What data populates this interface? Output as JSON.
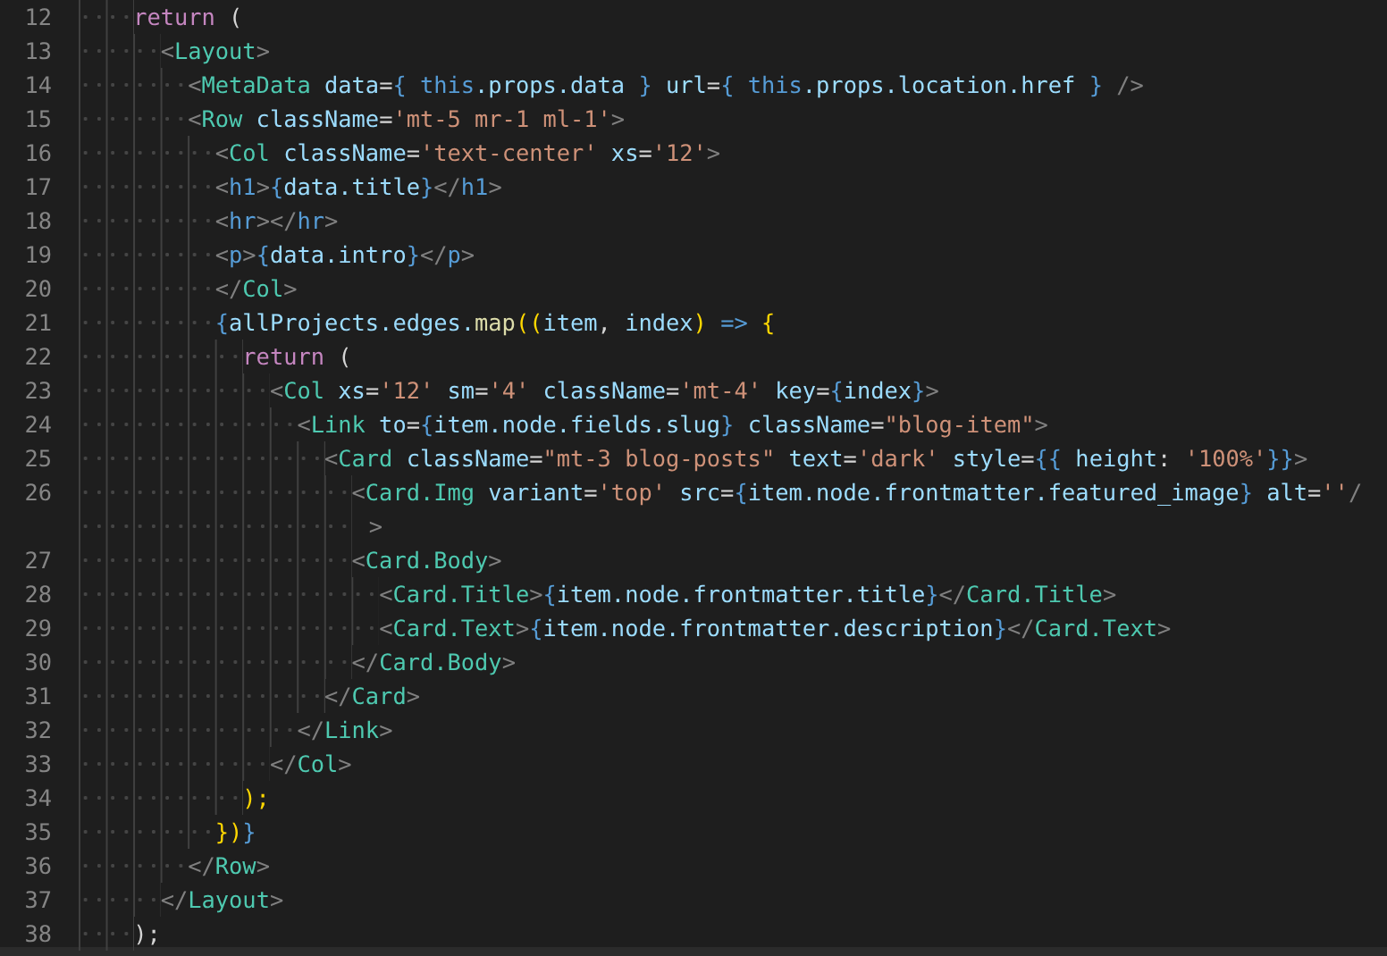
{
  "editor": {
    "lines": [
      {
        "number": "12",
        "tokens": [
          {
            "text": "    return",
            "kind": "keyword"
          },
          {
            "text": " (",
            "kind": "plain"
          }
        ]
      },
      {
        "number": "13",
        "tokens": [
          {
            "text": "      <",
            "kind": "punct"
          },
          {
            "text": "Layout",
            "kind": "tag"
          },
          {
            "text": ">",
            "kind": "punct"
          }
        ]
      },
      {
        "number": "14",
        "tokens": [
          {
            "text": "        <",
            "kind": "punct"
          },
          {
            "text": "MetaData",
            "kind": "tag"
          },
          {
            "text": " data",
            "kind": "attr"
          },
          {
            "text": "=",
            "kind": "plain"
          },
          {
            "text": "{",
            "kind": "brace"
          },
          {
            "text": " this",
            "kind": "this"
          },
          {
            "text": ".props.data ",
            "kind": "var"
          },
          {
            "text": "}",
            "kind": "brace"
          },
          {
            "text": " url",
            "kind": "attr"
          },
          {
            "text": "=",
            "kind": "plain"
          },
          {
            "text": "{",
            "kind": "brace"
          },
          {
            "text": " this",
            "kind": "this"
          },
          {
            "text": ".props.location.href ",
            "kind": "var"
          },
          {
            "text": "}",
            "kind": "brace"
          },
          {
            "text": " />",
            "kind": "punct"
          }
        ]
      },
      {
        "number": "15",
        "tokens": [
          {
            "text": "        <",
            "kind": "punct"
          },
          {
            "text": "Row",
            "kind": "tag"
          },
          {
            "text": " className",
            "kind": "attr"
          },
          {
            "text": "=",
            "kind": "plain"
          },
          {
            "text": "'mt-5 mr-1 ml-1'",
            "kind": "string"
          },
          {
            "text": ">",
            "kind": "punct"
          }
        ]
      },
      {
        "number": "16",
        "tokens": [
          {
            "text": "          <",
            "kind": "punct"
          },
          {
            "text": "Col",
            "kind": "tag"
          },
          {
            "text": " className",
            "kind": "attr"
          },
          {
            "text": "=",
            "kind": "plain"
          },
          {
            "text": "'text-center'",
            "kind": "string"
          },
          {
            "text": " xs",
            "kind": "attr"
          },
          {
            "text": "=",
            "kind": "plain"
          },
          {
            "text": "'12'",
            "kind": "string"
          },
          {
            "text": ">",
            "kind": "punct"
          }
        ]
      },
      {
        "number": "17",
        "tokens": [
          {
            "text": "          <",
            "kind": "punct"
          },
          {
            "text": "h1",
            "kind": "this"
          },
          {
            "text": ">",
            "kind": "punct"
          },
          {
            "text": "{",
            "kind": "brace"
          },
          {
            "text": "data.title",
            "kind": "var"
          },
          {
            "text": "}",
            "kind": "brace"
          },
          {
            "text": "</",
            "kind": "punct"
          },
          {
            "text": "h1",
            "kind": "this"
          },
          {
            "text": ">",
            "kind": "punct"
          }
        ]
      },
      {
        "number": "18",
        "tokens": [
          {
            "text": "          <",
            "kind": "punct"
          },
          {
            "text": "hr",
            "kind": "this"
          },
          {
            "text": "></",
            "kind": "punct"
          },
          {
            "text": "hr",
            "kind": "this"
          },
          {
            "text": ">",
            "kind": "punct"
          }
        ]
      },
      {
        "number": "19",
        "tokens": [
          {
            "text": "          <",
            "kind": "punct"
          },
          {
            "text": "p",
            "kind": "this"
          },
          {
            "text": ">",
            "kind": "punct"
          },
          {
            "text": "{",
            "kind": "brace"
          },
          {
            "text": "data.intro",
            "kind": "var"
          },
          {
            "text": "}",
            "kind": "brace"
          },
          {
            "text": "</",
            "kind": "punct"
          },
          {
            "text": "p",
            "kind": "this"
          },
          {
            "text": ">",
            "kind": "punct"
          }
        ]
      },
      {
        "number": "20",
        "tokens": [
          {
            "text": "          </",
            "kind": "punct"
          },
          {
            "text": "Col",
            "kind": "tag"
          },
          {
            "text": ">",
            "kind": "punct"
          }
        ]
      },
      {
        "number": "21",
        "tokens": [
          {
            "text": "          {",
            "kind": "brace"
          },
          {
            "text": "allProjects.edges.",
            "kind": "var"
          },
          {
            "text": "map",
            "kind": "func"
          },
          {
            "text": "((",
            "kind": "paren"
          },
          {
            "text": "item",
            "kind": "var"
          },
          {
            "text": ", ",
            "kind": "plain"
          },
          {
            "text": "index",
            "kind": "var"
          },
          {
            "text": ") ",
            "kind": "paren"
          },
          {
            "text": "=>",
            "kind": "this"
          },
          {
            "text": " {",
            "kind": "paren"
          }
        ]
      },
      {
        "number": "22",
        "tokens": [
          {
            "text": "            return",
            "kind": "keyword"
          },
          {
            "text": " (",
            "kind": "plain"
          }
        ]
      },
      {
        "number": "23",
        "tokens": [
          {
            "text": "              <",
            "kind": "punct"
          },
          {
            "text": "Col",
            "kind": "tag"
          },
          {
            "text": " xs",
            "kind": "attr"
          },
          {
            "text": "=",
            "kind": "plain"
          },
          {
            "text": "'12'",
            "kind": "string"
          },
          {
            "text": " sm",
            "kind": "attr"
          },
          {
            "text": "=",
            "kind": "plain"
          },
          {
            "text": "'4'",
            "kind": "string"
          },
          {
            "text": " className",
            "kind": "attr"
          },
          {
            "text": "=",
            "kind": "plain"
          },
          {
            "text": "'mt-4'",
            "kind": "string"
          },
          {
            "text": " key",
            "kind": "attr"
          },
          {
            "text": "=",
            "kind": "plain"
          },
          {
            "text": "{",
            "kind": "brace"
          },
          {
            "text": "index",
            "kind": "var"
          },
          {
            "text": "}",
            "kind": "brace"
          },
          {
            "text": ">",
            "kind": "punct"
          }
        ]
      },
      {
        "number": "24",
        "tokens": [
          {
            "text": "                <",
            "kind": "punct"
          },
          {
            "text": "Link",
            "kind": "tag"
          },
          {
            "text": " to",
            "kind": "attr"
          },
          {
            "text": "=",
            "kind": "plain"
          },
          {
            "text": "{",
            "kind": "brace"
          },
          {
            "text": "item.node.fields.slug",
            "kind": "var"
          },
          {
            "text": "}",
            "kind": "brace"
          },
          {
            "text": " className",
            "kind": "attr"
          },
          {
            "text": "=",
            "kind": "plain"
          },
          {
            "text": "\"blog-item\"",
            "kind": "string"
          },
          {
            "text": ">",
            "kind": "punct"
          }
        ]
      },
      {
        "number": "25",
        "tokens": [
          {
            "text": "                  <",
            "kind": "punct"
          },
          {
            "text": "Card",
            "kind": "tag"
          },
          {
            "text": " className",
            "kind": "attr"
          },
          {
            "text": "=",
            "kind": "plain"
          },
          {
            "text": "\"mt-3 blog-posts\"",
            "kind": "string"
          },
          {
            "text": " text",
            "kind": "attr"
          },
          {
            "text": "=",
            "kind": "plain"
          },
          {
            "text": "'dark'",
            "kind": "string"
          },
          {
            "text": " style",
            "kind": "attr"
          },
          {
            "text": "=",
            "kind": "plain"
          },
          {
            "text": "{{",
            "kind": "brace"
          },
          {
            "text": " height",
            "kind": "var"
          },
          {
            "text": ": ",
            "kind": "plain"
          },
          {
            "text": "'100%'",
            "kind": "string"
          },
          {
            "text": "}}",
            "kind": "brace"
          },
          {
            "text": ">",
            "kind": "punct"
          }
        ]
      },
      {
        "number": "26",
        "tokens": [
          {
            "text": "                    <",
            "kind": "punct"
          },
          {
            "text": "Card.Img",
            "kind": "tag"
          },
          {
            "text": " variant",
            "kind": "attr"
          },
          {
            "text": "=",
            "kind": "plain"
          },
          {
            "text": "'top'",
            "kind": "string"
          },
          {
            "text": " src",
            "kind": "attr"
          },
          {
            "text": "=",
            "kind": "plain"
          },
          {
            "text": "{",
            "kind": "brace"
          },
          {
            "text": "item.node.frontmatter.featured_image",
            "kind": "var"
          },
          {
            "text": "}",
            "kind": "brace"
          },
          {
            "text": " alt",
            "kind": "attr"
          },
          {
            "text": "=",
            "kind": "plain"
          },
          {
            "text": "''",
            "kind": "string"
          },
          {
            "text": "/",
            "kind": "punct"
          }
        ],
        "wrap_tokens": [
          {
            "text": ">",
            "kind": "punct"
          }
        ]
      },
      {
        "number": "27",
        "tokens": [
          {
            "text": "                    <",
            "kind": "punct"
          },
          {
            "text": "Card.Body",
            "kind": "tag"
          },
          {
            "text": ">",
            "kind": "punct"
          }
        ]
      },
      {
        "number": "28",
        "tokens": [
          {
            "text": "                      <",
            "kind": "punct"
          },
          {
            "text": "Card.Title",
            "kind": "tag"
          },
          {
            "text": ">",
            "kind": "punct"
          },
          {
            "text": "{",
            "kind": "brace"
          },
          {
            "text": "item.node.frontmatter.title",
            "kind": "var"
          },
          {
            "text": "}",
            "kind": "brace"
          },
          {
            "text": "</",
            "kind": "punct"
          },
          {
            "text": "Card.Title",
            "kind": "tag"
          },
          {
            "text": ">",
            "kind": "punct"
          }
        ]
      },
      {
        "number": "29",
        "tokens": [
          {
            "text": "                      <",
            "kind": "punct"
          },
          {
            "text": "Card.Text",
            "kind": "tag"
          },
          {
            "text": ">",
            "kind": "punct"
          },
          {
            "text": "{",
            "kind": "brace"
          },
          {
            "text": "item.node.frontmatter.description",
            "kind": "var"
          },
          {
            "text": "}",
            "kind": "brace"
          },
          {
            "text": "</",
            "kind": "punct"
          },
          {
            "text": "Card.Text",
            "kind": "tag"
          },
          {
            "text": ">",
            "kind": "punct"
          }
        ]
      },
      {
        "number": "30",
        "tokens": [
          {
            "text": "                    </",
            "kind": "punct"
          },
          {
            "text": "Card.Body",
            "kind": "tag"
          },
          {
            "text": ">",
            "kind": "punct"
          }
        ]
      },
      {
        "number": "31",
        "tokens": [
          {
            "text": "                  </",
            "kind": "punct"
          },
          {
            "text": "Card",
            "kind": "tag"
          },
          {
            "text": ">",
            "kind": "punct"
          }
        ]
      },
      {
        "number": "32",
        "tokens": [
          {
            "text": "                </",
            "kind": "punct"
          },
          {
            "text": "Link",
            "kind": "tag"
          },
          {
            "text": ">",
            "kind": "punct"
          }
        ]
      },
      {
        "number": "33",
        "tokens": [
          {
            "text": "              </",
            "kind": "punct"
          },
          {
            "text": "Col",
            "kind": "tag"
          },
          {
            "text": ">",
            "kind": "punct"
          }
        ]
      },
      {
        "number": "34",
        "tokens": [
          {
            "text": "            );",
            "kind": "paren"
          }
        ]
      },
      {
        "number": "35",
        "tokens": [
          {
            "text": "          })",
            "kind": "paren"
          },
          {
            "text": "}",
            "kind": "brace"
          }
        ]
      },
      {
        "number": "36",
        "tokens": [
          {
            "text": "        </",
            "kind": "punct"
          },
          {
            "text": "Row",
            "kind": "tag"
          },
          {
            "text": ">",
            "kind": "punct"
          }
        ]
      },
      {
        "number": "37",
        "tokens": [
          {
            "text": "      </",
            "kind": "punct"
          },
          {
            "text": "Layout",
            "kind": "tag"
          },
          {
            "text": ">",
            "kind": "punct"
          }
        ]
      },
      {
        "number": "38",
        "tokens": [
          {
            "text": "    );",
            "kind": "plain"
          }
        ]
      }
    ]
  }
}
